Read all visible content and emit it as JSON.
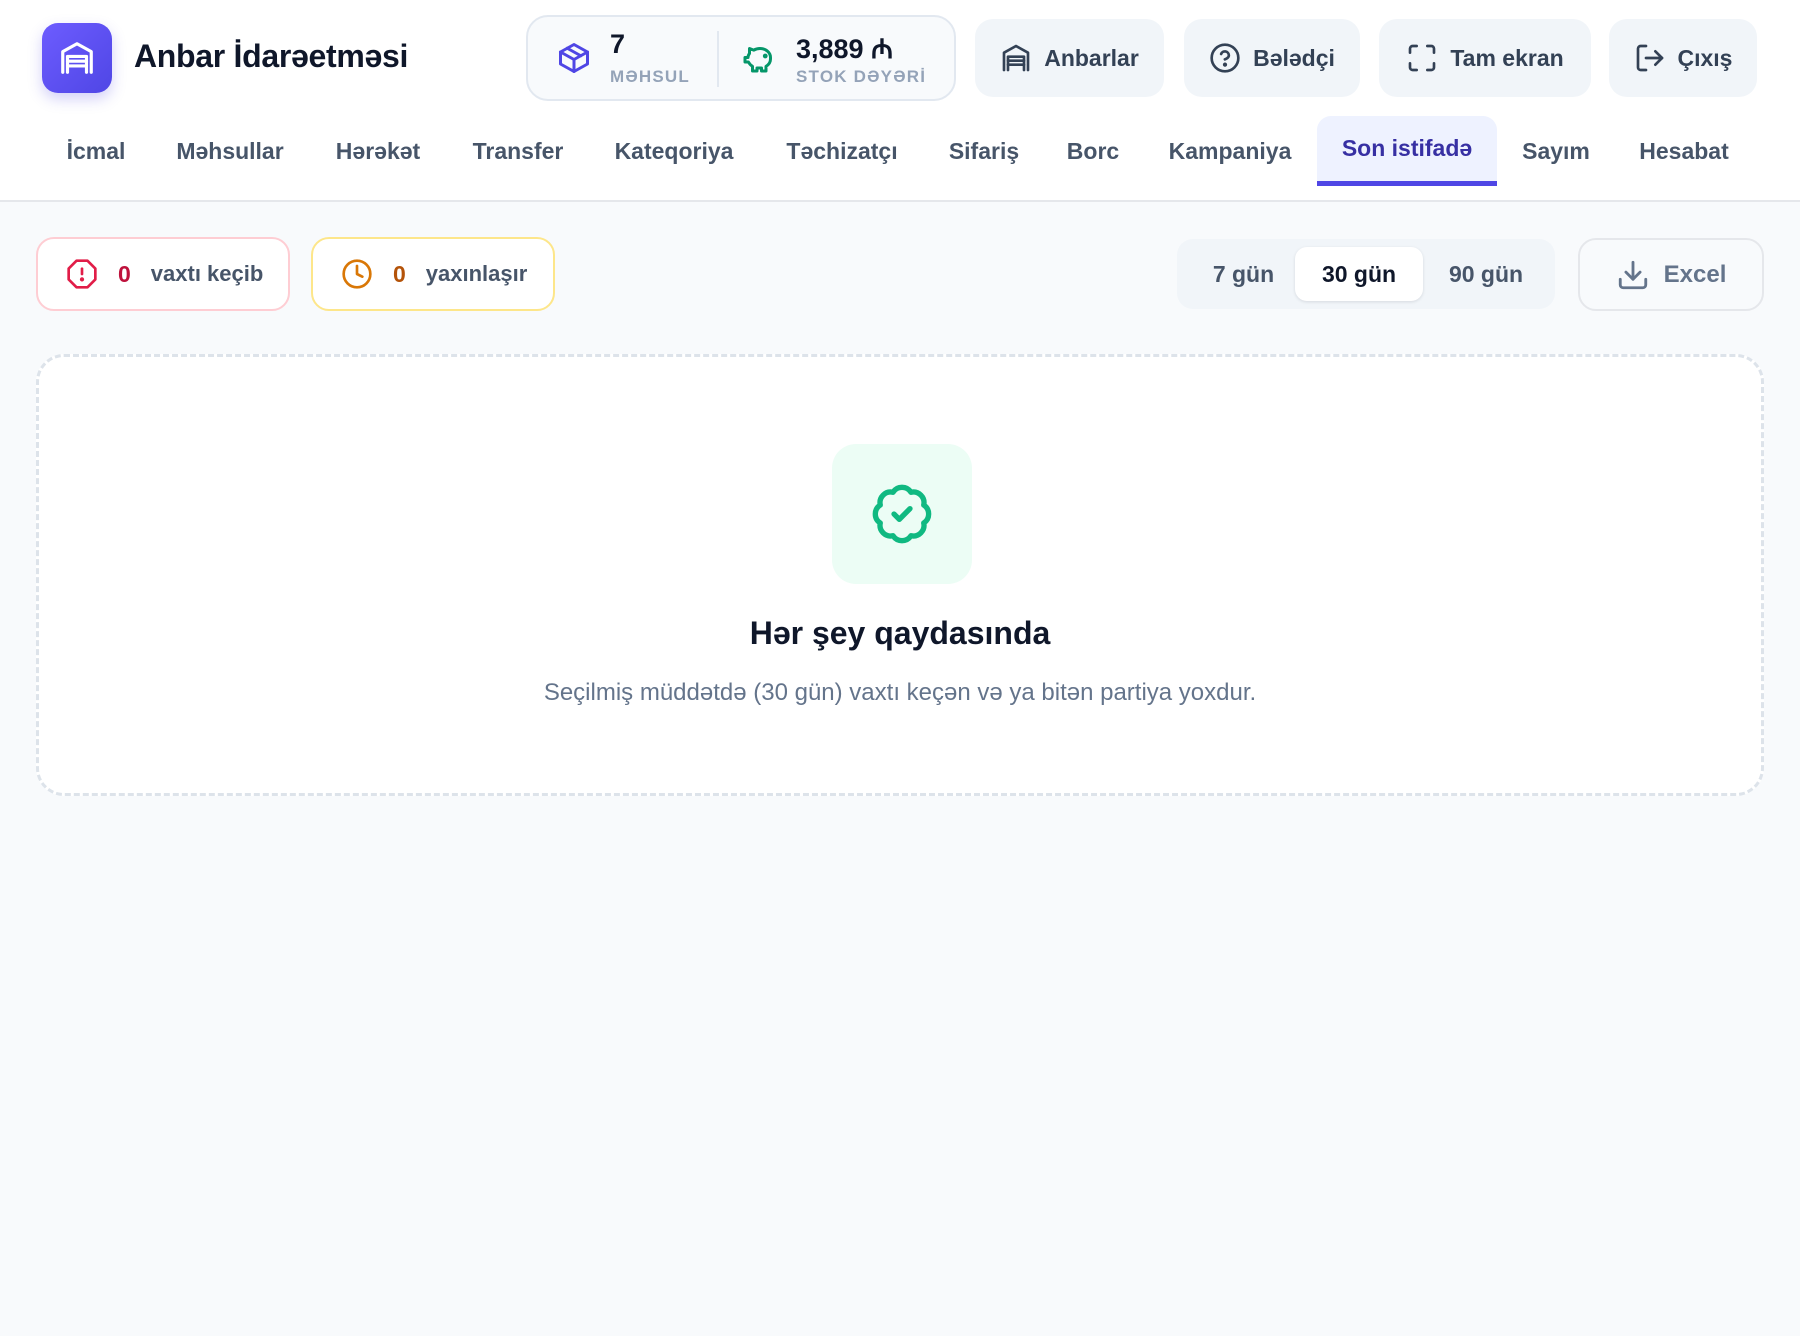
{
  "app": {
    "title": "Anbar İdarəetməsi"
  },
  "stats": {
    "products": {
      "value": "7",
      "label": "MƏHSUL"
    },
    "stock": {
      "value": "3,889 ₼",
      "label": "STOK DƏYƏRİ"
    }
  },
  "header_buttons": {
    "warehouses": "Anbarlar",
    "guide": "Bələdçi",
    "fullscreen": "Tam ekran",
    "logout": "Çıxış"
  },
  "tabs": [
    {
      "label": "İcmal"
    },
    {
      "label": "Məhsullar"
    },
    {
      "label": "Hərəkət"
    },
    {
      "label": "Transfer"
    },
    {
      "label": "Kateqoriya"
    },
    {
      "label": "Təchizatçı"
    },
    {
      "label": "Sifariş"
    },
    {
      "label": "Borc"
    },
    {
      "label": "Kampaniya"
    },
    {
      "label": "Son istifadə",
      "active": true
    },
    {
      "label": "Sayım"
    },
    {
      "label": "Hesabat"
    }
  ],
  "filters": {
    "expired": {
      "count": "0",
      "label": "vaxtı keçib",
      "color": "#be123c"
    },
    "approaching": {
      "count": "0",
      "label": "yaxınlaşır",
      "color": "#b45309"
    }
  },
  "periods": [
    {
      "label": "7 gün"
    },
    {
      "label": "30 gün",
      "active": true
    },
    {
      "label": "90 gün"
    }
  ],
  "export": {
    "label": "Excel"
  },
  "empty_state": {
    "title": "Hər şey qaydasında",
    "message": "Seçilmiş müddətdə (30 gün) vaxtı keçən və ya bitən partiya yoxdur."
  },
  "colors": {
    "accent": "#4f46e5",
    "success": "#10b981"
  },
  "icons": [
    "warehouse-icon",
    "box-icon",
    "piggy-bank-icon",
    "help-circle-icon",
    "fullscreen-icon",
    "logout-icon",
    "alert-octagon-icon",
    "clock-icon",
    "download-icon",
    "badge-check-icon"
  ]
}
